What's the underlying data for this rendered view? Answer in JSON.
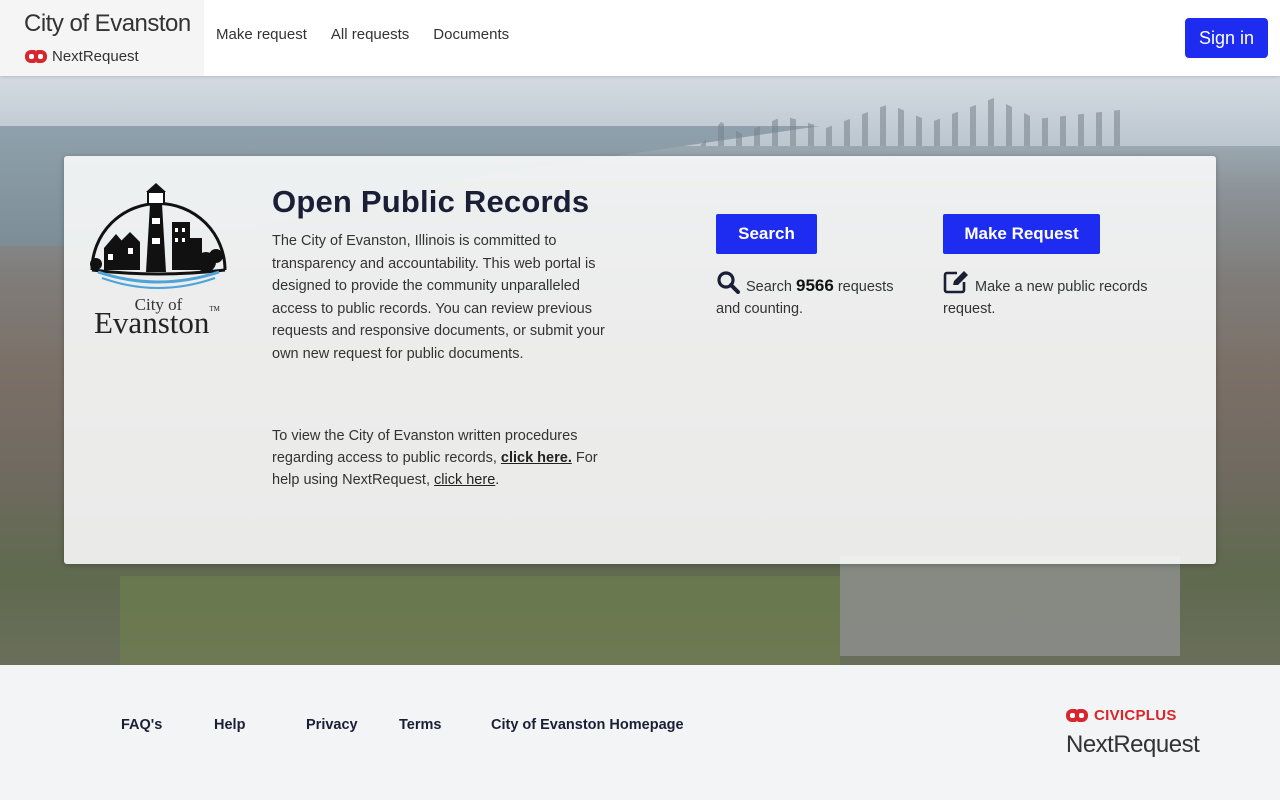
{
  "header": {
    "brand_title": "City of Evanston",
    "brand_sub": "NextRequest",
    "nav": [
      "Make request",
      "All requests",
      "Documents"
    ],
    "signin_label": "Sign in"
  },
  "hero": {
    "title": "Open Public Records",
    "description": "The City of Evanston, Illinois is committed to transparency and accountability. This web portal is designed to provide the community unparalleled access to public records. You can review previous requests and responsive documents, or submit your own new request for public documents.",
    "procedures_prefix": "To view the City of Evanston written procedures regarding access to public records, ",
    "procedures_link": "click here.",
    "help_prefix": " For help using NextRequest, ",
    "help_link": "click here",
    "help_suffix": ".",
    "logo_city": "City of",
    "logo_name": "Evanston",
    "logo_tm": "TM",
    "search_button": "Search",
    "search_prefix": "Search ",
    "search_count": "9566",
    "search_suffix": " requests and counting.",
    "request_button": "Make Request",
    "request_text": "Make a new public records request.",
    "icons": {
      "search": "search-icon",
      "request": "edit-icon"
    }
  },
  "footer": {
    "links": [
      "FAQ's",
      "Help",
      "Privacy",
      "Terms",
      "City of Evanston Homepage"
    ],
    "civic_brand": "CIVICPLUS",
    "civic_product": "NextRequest"
  },
  "colors": {
    "primary": "#1e2bf0",
    "brand_red": "#d9262c",
    "title": "#1a1f36"
  }
}
